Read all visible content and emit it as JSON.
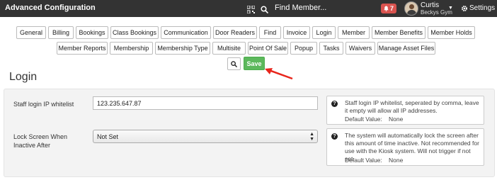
{
  "header": {
    "title": "Advanced Configuration",
    "search_placeholder": "Find Member...",
    "notification_count": "7",
    "user_name": "Curtis",
    "user_gym": "Beckys Gym",
    "settings_label": "Settings"
  },
  "tabs_row1": [
    "General",
    "Billing",
    "Bookings",
    "Class Bookings",
    "Communication",
    "Door Readers",
    "Find",
    "Invoice",
    "Login",
    "Member",
    "Member Benefits",
    "Member Holds"
  ],
  "tabs_row2": [
    "Member Reports",
    "Membership",
    "Membership Type",
    "Multisite",
    "Point Of Sale",
    "Popup",
    "Tasks",
    "Waivers",
    "Manage Asset Files"
  ],
  "actions": {
    "save_label": "Save"
  },
  "section": {
    "title": "Login"
  },
  "fields": [
    {
      "label": "Staff login IP whitelist",
      "value": "123.235.647.87",
      "help": "Staff login IP whitelist, seperated by comma, leave it empty will allow all IP addresses.",
      "default_label": "Default Value:",
      "default_value": "None"
    },
    {
      "label": "Lock Screen When Inactive After",
      "value": "Not Set",
      "help": "The system will automatically lock the screen after this amount of time inactive. Not recommended for use with the Kiosk system. Will not trigger if not set.",
      "default_label": "Default Value:",
      "default_value": "None"
    }
  ],
  "colors": {
    "topbar": "#333333",
    "save": "#5cb85c",
    "badge": "#d9534f",
    "arrow": "#e8261c"
  }
}
